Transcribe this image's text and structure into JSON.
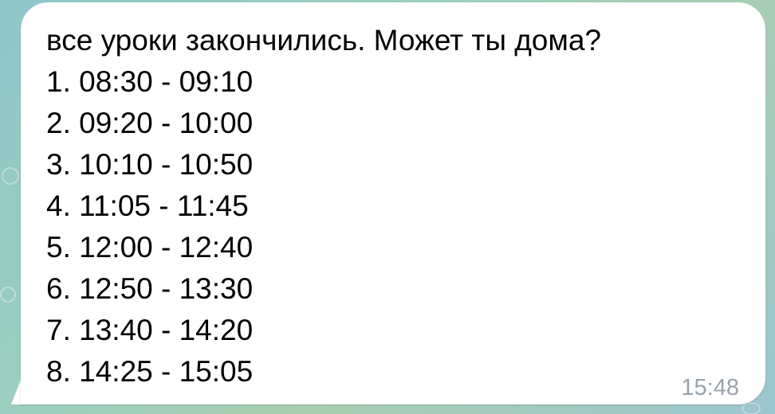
{
  "message": {
    "text_first_line": "все уроки закончились. Может ты дома?",
    "schedule": [
      "1. 08:30 - 09:10",
      "2. 09:20 - 10:00",
      "3. 10:10 - 10:50",
      "4. 11:05 - 11:45",
      "5. 12:00 - 12:40",
      "6. 12:50 - 13:30",
      "7. 13:40 - 14:20",
      "8. 14:25 - 15:05"
    ],
    "time": "15:48"
  },
  "colors": {
    "bubble": "#ffffff",
    "timestamp": "#9aa3ad",
    "background": "#9ccfc0"
  }
}
